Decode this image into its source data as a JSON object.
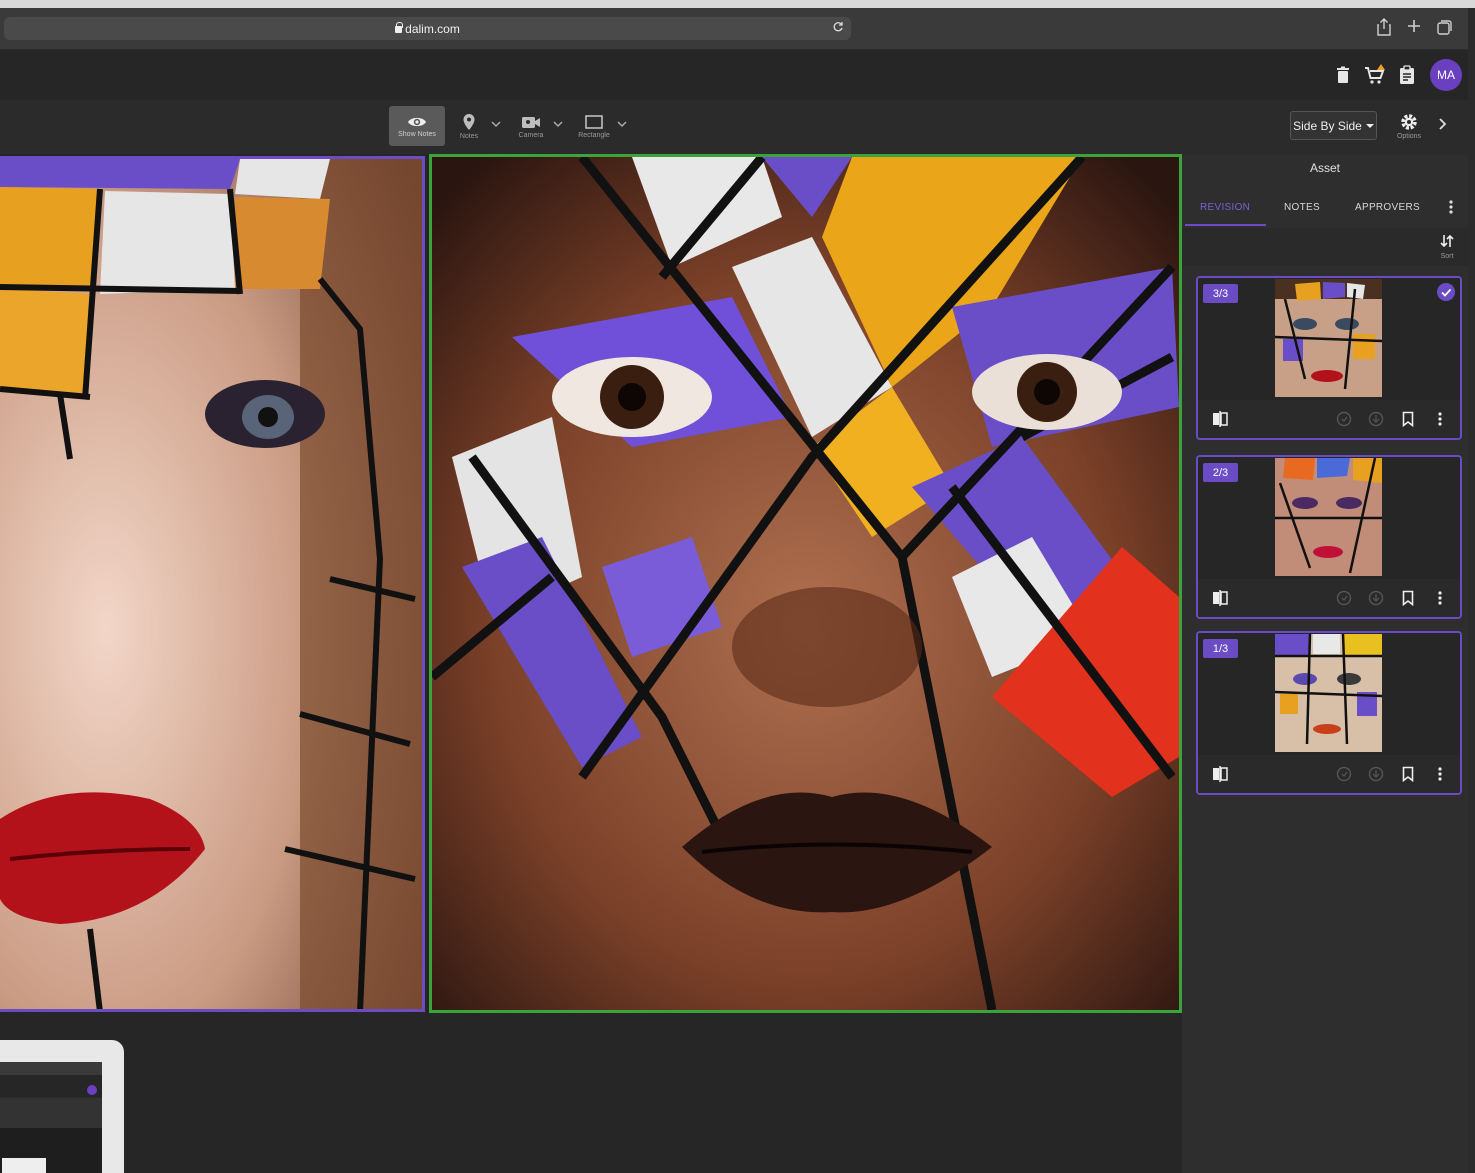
{
  "browser": {
    "url": "dalim.com"
  },
  "header": {
    "avatar_initials": "MA",
    "icons": [
      "trash-icon",
      "cart-icon",
      "clipboard-icon"
    ],
    "cart_badge_color": "#f0a020"
  },
  "toolbar": {
    "tools": [
      {
        "name": "show-notes",
        "label": "Show Notes",
        "icon": "eye-icon"
      },
      {
        "name": "notes",
        "label": "Notes",
        "icon": "pin-icon"
      },
      {
        "name": "camera",
        "label": "Camera",
        "icon": "camera-icon"
      },
      {
        "name": "rectangle",
        "label": "Rectangle",
        "icon": "rectangle-icon"
      }
    ],
    "view_mode": "Side By Side",
    "options_label": "Options"
  },
  "panel": {
    "title": "Asset",
    "tabs": [
      "REVISION",
      "NOTES",
      "APPROVERS"
    ],
    "sort_label": "Sort",
    "revisions": [
      {
        "label": "3/3",
        "approved": true
      },
      {
        "label": "2/3",
        "approved": false
      },
      {
        "label": "1/3",
        "approved": false
      }
    ]
  },
  "colors": {
    "accent": "#6b4cc4",
    "compare_frame": "#3aa33a"
  }
}
